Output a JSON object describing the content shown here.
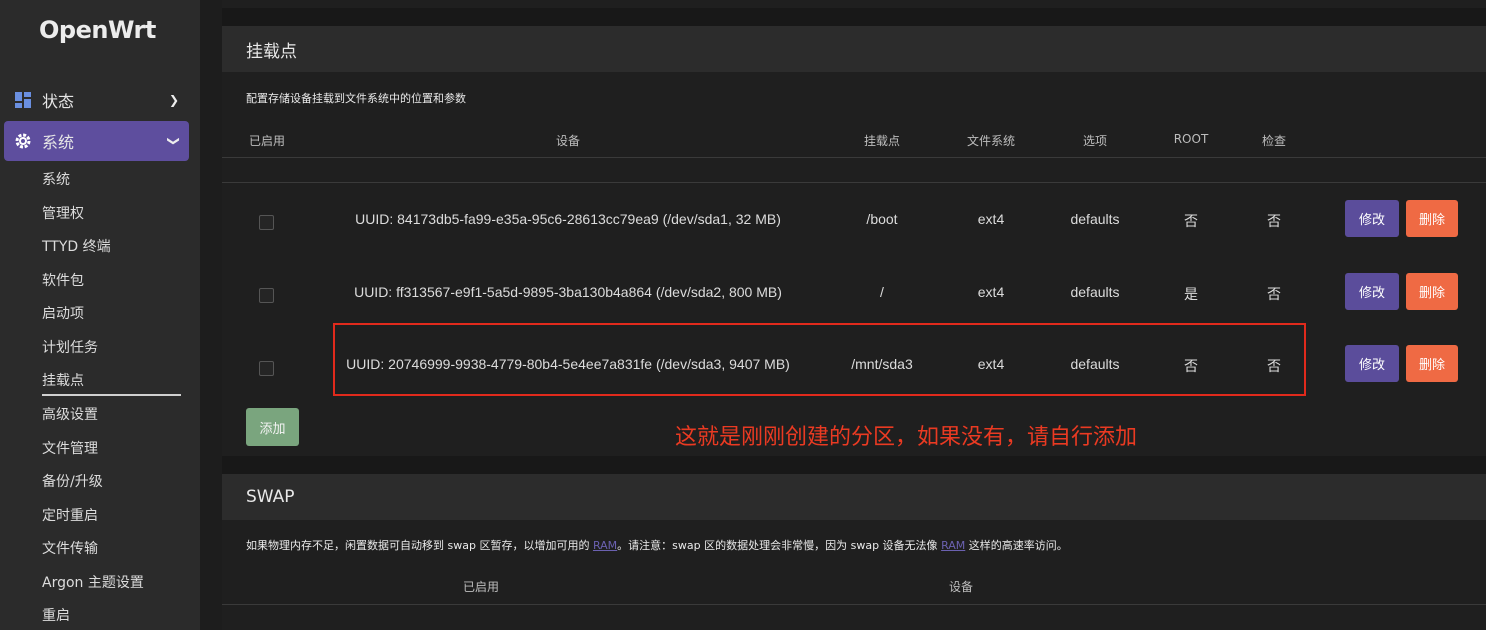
{
  "brand": "OpenWrt",
  "sidebar": {
    "top_items": [
      {
        "label": "状态",
        "icon": "dashboard-icon"
      },
      {
        "label": "系统",
        "icon": "gear-icon"
      }
    ],
    "sub_items": [
      "系统",
      "管理权",
      "TTYD 终端",
      "软件包",
      "启动项",
      "计划任务",
      "挂载点",
      "高级设置",
      "文件管理",
      "备份/升级",
      "定时重启",
      "文件传输",
      "Argon 主题设置",
      "重启"
    ]
  },
  "mount": {
    "title": "挂载点",
    "description": "配置存储设备挂载到文件系统中的位置和参数",
    "headers": [
      "已启用",
      "设备",
      "挂载点",
      "文件系统",
      "选项",
      "ROOT",
      "检查"
    ],
    "rows": [
      {
        "device": "UUID: 84173db5-fa99-e35a-95c6-28613cc79ea9 (/dev/sda1, 32 MB)",
        "mountpoint": "/boot",
        "fs": "ext4",
        "options": "defaults",
        "root": "否",
        "check": "否",
        "enabled": false
      },
      {
        "device": "UUID: ff313567-e9f1-5a5d-9895-3ba130b4a864 (/dev/sda2, 800 MB)",
        "mountpoint": "/",
        "fs": "ext4",
        "options": "defaults",
        "root": "是",
        "check": "否",
        "enabled": false
      },
      {
        "device": "UUID: 20746999-9938-4779-80b4-5e4ee7a831fe (/dev/sda3, 9407 MB)",
        "mountpoint": "/mnt/sda3",
        "fs": "ext4",
        "options": "defaults",
        "root": "否",
        "check": "否",
        "enabled": false
      }
    ],
    "edit_label": "修改",
    "delete_label": "删除",
    "add_label": "添加"
  },
  "annotation": "这就是刚刚创建的分区，如果没有，请自行添加",
  "swap": {
    "title": "SWAP",
    "desc_part1": "如果物理内存不足，闲置数据可自动移到 swap 区暂存，以增加可用的 ",
    "ram_link": "RAM",
    "desc_part2": "。请注意：swap 区的数据处理会非常慢，因为 swap 设备无法像 ",
    "desc_part3": " 这样的高速率访问。",
    "headers": [
      "已启用",
      "设备"
    ]
  },
  "colors": {
    "accent": "#5e4e9e",
    "danger": "#ef6a44",
    "success": "#7aa57e",
    "annotation": "#e02a1c"
  }
}
